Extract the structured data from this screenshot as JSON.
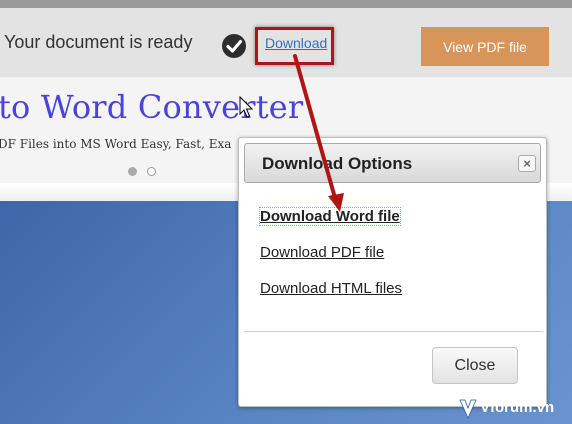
{
  "status_bar": {
    "message": "Your document is ready",
    "download_link": "Download",
    "view_pdf_button": "View PDF file"
  },
  "hero": {
    "title": "to Word Converter",
    "subtitle": "DF Files into MS Word Easy, Fast, Exa"
  },
  "dialog": {
    "title": "Download Options",
    "close_x": "×",
    "options": [
      "Download Word file",
      "Download PDF file",
      "Download HTML files"
    ],
    "close_button": "Close"
  },
  "watermark": {
    "text": "Vforum.vn"
  },
  "colors": {
    "annotation_red": "#b01414",
    "button_orange": "#d7955a",
    "hero_title_blue": "#4b43d9",
    "background_blue": "#4f78b8"
  },
  "icons": [
    "checkmark-circle-icon",
    "close-x-icon",
    "mouse-pointer-icon"
  ]
}
